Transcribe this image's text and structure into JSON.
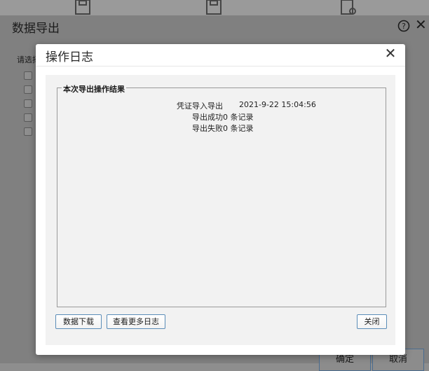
{
  "toolbar_icons": [
    "save-icon",
    "save-as-icon",
    "document-settings-icon"
  ],
  "outer_dialog": {
    "title": "数据导出",
    "select_label": "请选择",
    "confirm_label": "确定",
    "cancel_label": "取消"
  },
  "modal": {
    "title": "操作日志",
    "section_title": "本次导出操作结果",
    "log": {
      "line1_label": "凭证导入导出",
      "line1_time": "2021-9-22 15:04:56",
      "line2": "导出成功0 条记录",
      "line3": "导出失败0 条记录"
    },
    "buttons": {
      "download": "数据下载",
      "more_logs": "查看更多日志",
      "close": "关闭"
    }
  }
}
